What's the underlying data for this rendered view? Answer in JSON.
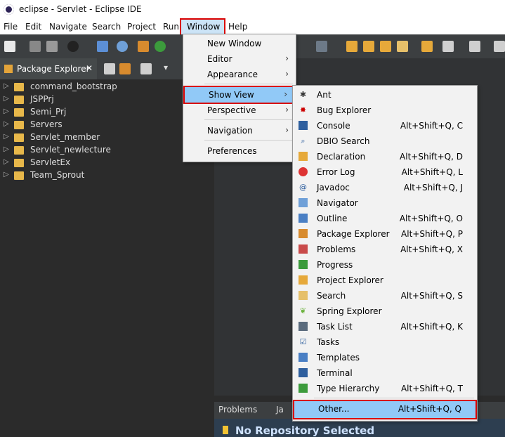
{
  "window": {
    "title": "eclipse - Servlet - Eclipse IDE"
  },
  "menubar": [
    "File",
    "Edit",
    "Navigate",
    "Search",
    "Project",
    "Run",
    "Window",
    "Help"
  ],
  "package_explorer": {
    "tab_label": "Package Explorer",
    "projects": [
      "command_bootstrap",
      "JSPPrj",
      "Semi_Prj",
      "Servers",
      "Servlet_member",
      "Servlet_newlecture",
      "ServletEx",
      "Team_Sprout"
    ]
  },
  "window_menu": {
    "items": [
      {
        "label": "New Window",
        "submenu": false
      },
      {
        "label": "Editor",
        "submenu": true
      },
      {
        "label": "Appearance",
        "submenu": true
      },
      {
        "label": "Show View",
        "submenu": true,
        "selected": true
      },
      {
        "label": "Perspective",
        "submenu": true
      },
      {
        "label": "Navigation",
        "submenu": true
      },
      {
        "label": "Preferences",
        "submenu": false
      }
    ]
  },
  "show_view_menu": {
    "items": [
      {
        "label": "Ant",
        "shortcut": "",
        "icon": "ant-icon"
      },
      {
        "label": "Bug Explorer",
        "shortcut": "",
        "icon": "bug-icon"
      },
      {
        "label": "Console",
        "shortcut": "Alt+Shift+Q, C",
        "icon": "console-icon"
      },
      {
        "label": "DBIO Search",
        "shortcut": "",
        "icon": "search-db-icon"
      },
      {
        "label": "Declaration",
        "shortcut": "Alt+Shift+Q, D",
        "icon": "declaration-icon"
      },
      {
        "label": "Error Log",
        "shortcut": "Alt+Shift+Q, L",
        "icon": "error-log-icon"
      },
      {
        "label": "Javadoc",
        "shortcut": "Alt+Shift+Q, J",
        "icon": "javadoc-icon"
      },
      {
        "label": "Navigator",
        "shortcut": "",
        "icon": "navigator-icon"
      },
      {
        "label": "Outline",
        "shortcut": "Alt+Shift+Q, O",
        "icon": "outline-icon"
      },
      {
        "label": "Package Explorer",
        "shortcut": "Alt+Shift+Q, P",
        "icon": "package-explorer-icon"
      },
      {
        "label": "Problems",
        "shortcut": "Alt+Shift+Q, X",
        "icon": "problems-icon"
      },
      {
        "label": "Progress",
        "shortcut": "",
        "icon": "progress-icon"
      },
      {
        "label": "Project Explorer",
        "shortcut": "",
        "icon": "project-explorer-icon"
      },
      {
        "label": "Search",
        "shortcut": "Alt+Shift+Q, S",
        "icon": "search-icon"
      },
      {
        "label": "Spring Explorer",
        "shortcut": "",
        "icon": "spring-icon"
      },
      {
        "label": "Task List",
        "shortcut": "Alt+Shift+Q, K",
        "icon": "task-list-icon"
      },
      {
        "label": "Tasks",
        "shortcut": "",
        "icon": "tasks-icon"
      },
      {
        "label": "Templates",
        "shortcut": "",
        "icon": "templates-icon"
      },
      {
        "label": "Terminal",
        "shortcut": "",
        "icon": "terminal-icon"
      },
      {
        "label": "Type Hierarchy",
        "shortcut": "Alt+Shift+Q, T",
        "icon": "type-hierarchy-icon"
      },
      {
        "label": "Other...",
        "shortcut": "Alt+Shift+Q, Q",
        "icon": "",
        "selected": true
      }
    ]
  },
  "bottom": {
    "problems_tab": "Problems",
    "j_tab": "Ja",
    "no_repo": "No Repository Selected"
  },
  "colors": {
    "highlight_border": "#d90000",
    "selection": "#91c9f7",
    "dark_bg": "#2b2b2b"
  }
}
